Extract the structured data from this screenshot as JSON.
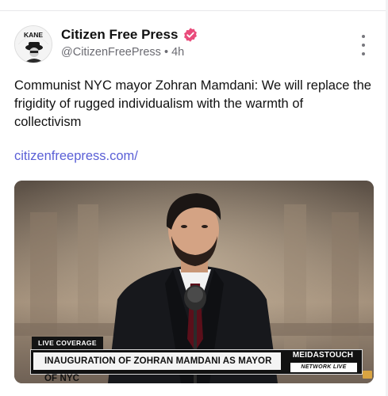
{
  "post": {
    "author": {
      "display_name": "Citizen Free Press",
      "handle": "@CitizenFreePress",
      "separator": "•",
      "time": "4h",
      "verified": true,
      "verified_color": "#e94b7b",
      "avatar_text": "KANE"
    },
    "text": "Communist NYC mayor Zohran Mamdani: We will replace the frigidity of rugged individualism with the warmth of collectivism",
    "link": "citizenfreepress.com/",
    "link_color": "#5a5fd6",
    "video": {
      "live_tag": "LIVE COVERAGE",
      "headline": "INAUGURATION OF ZOHRAN MAMDANI AS MAYOR OF NYC",
      "brand": "MEIDASTOUCH",
      "brand_sub": "NETWORK LIVE"
    }
  },
  "icons": {
    "verified": "verified-badge-icon",
    "more": "more-vertical-icon"
  }
}
